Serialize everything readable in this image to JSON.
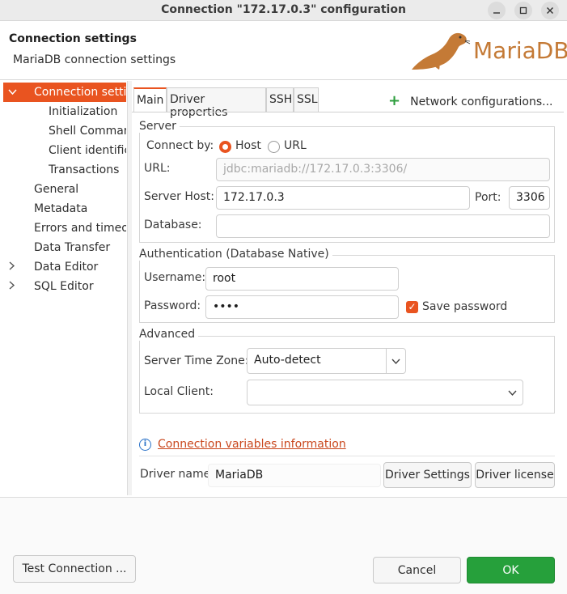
{
  "window": {
    "title": "Connection \"172.17.0.3\" configuration",
    "controls": [
      "minimize",
      "maximize",
      "close"
    ]
  },
  "header": {
    "title": "Connection settings",
    "subtitle": "MariaDB connection settings",
    "logo_text": "MariaDB"
  },
  "tree": {
    "items": [
      {
        "label": "Connection settings",
        "selected": true,
        "expanded": true
      },
      {
        "label": "Initialization"
      },
      {
        "label": "Shell Commands"
      },
      {
        "label": "Client identification"
      },
      {
        "label": "Transactions"
      },
      {
        "label": "General"
      },
      {
        "label": "Metadata"
      },
      {
        "label": "Errors and timeouts"
      },
      {
        "label": "Data Transfer"
      },
      {
        "label": "Data Editor",
        "expandable": true
      },
      {
        "label": "SQL Editor",
        "expandable": true
      }
    ]
  },
  "tabs": [
    "Main",
    "Driver properties",
    "SSH",
    "SSL"
  ],
  "active_tab": "Main",
  "network_config_label": "Network configurations...",
  "server": {
    "group_label": "Server",
    "connect_by_label": "Connect by:",
    "host_option": "Host",
    "url_option": "URL",
    "selected": "Host",
    "url_label": "URL:",
    "url_value": "jdbc:mariadb://172.17.0.3:3306/",
    "host_label": "Server Host:",
    "host_value": "172.17.0.3",
    "port_label": "Port:",
    "port_value": "3306",
    "database_label": "Database:",
    "database_value": ""
  },
  "auth": {
    "group_label": "Authentication (Database Native)",
    "username_label": "Username:",
    "username_value": "root",
    "password_label": "Password:",
    "password_value": "••••",
    "save_password_label": "Save password",
    "save_password_checked": true
  },
  "advanced": {
    "group_label": "Advanced",
    "timezone_label": "Server Time Zone:",
    "timezone_value": "Auto-detect",
    "local_client_label": "Local Client:",
    "local_client_value": ""
  },
  "info_link": "Connection variables information",
  "driver": {
    "name_label": "Driver name:",
    "name_value": "MariaDB",
    "settings_button": "Driver Settings",
    "license_button": "Driver license"
  },
  "buttons": {
    "test": "Test Connection ...",
    "cancel": "Cancel",
    "ok": "OK"
  },
  "colors": {
    "accent": "#e95420",
    "ok_green": "#26a03b",
    "link": "#c9471d"
  }
}
